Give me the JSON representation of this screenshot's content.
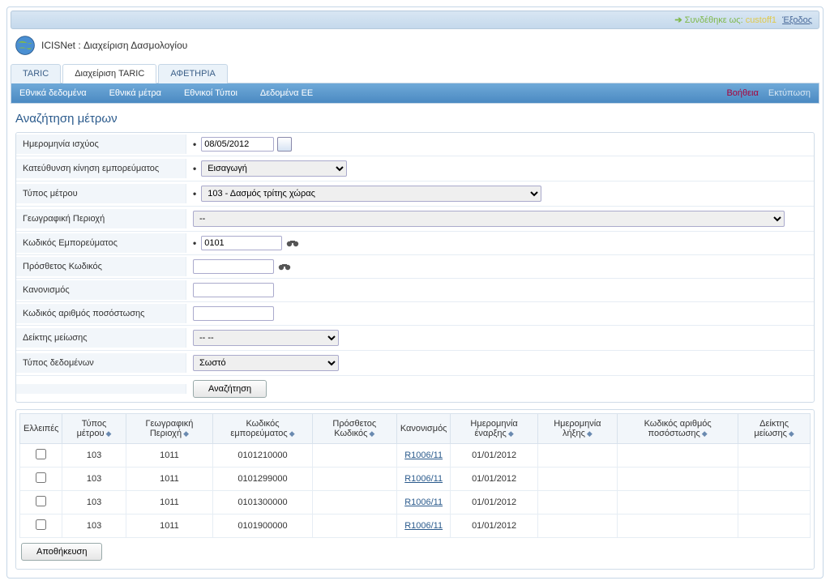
{
  "topbar": {
    "login_text": "Συνδέθηκε ως:",
    "user": "custoff1",
    "logout": "Έξοδος"
  },
  "brand": {
    "title": "ICISNet : Διαχείριση Δασμολογίου"
  },
  "tabs": [
    {
      "id": "taric",
      "label": "TARIC"
    },
    {
      "id": "manage-taric",
      "label": "Διαχείριση TARIC"
    },
    {
      "id": "departure",
      "label": "ΑΦΕΤΗΡΙΑ"
    }
  ],
  "menu": {
    "items": [
      "Εθνικά δεδομένα",
      "Εθνικά μέτρα",
      "Εθνικοί Τύποι",
      "Δεδομένα ΕΕ"
    ],
    "help": "Βοήθεια",
    "print": "Εκτύπωση"
  },
  "page": {
    "title": "Αναζήτηση μέτρων"
  },
  "form": {
    "validity_date": {
      "label": "Ημερομηνία ισχύος",
      "value": "08/05/2012"
    },
    "movement_direction": {
      "label": "Κατεύθυνση κίνηση εμπορεύματος",
      "value": "Εισαγωγή"
    },
    "measure_type": {
      "label": "Τύπος μέτρου",
      "value": "103 - Δασμός τρίτης χώρας"
    },
    "geo_area": {
      "label": "Γεωγραφική Περιοχή",
      "value": "--"
    },
    "commodity_code": {
      "label": "Κωδικός Εμπορεύματος",
      "value": "0101"
    },
    "additional_code": {
      "label": "Πρόσθετος Κωδικός",
      "value": ""
    },
    "regulation": {
      "label": "Κανονισμός",
      "value": ""
    },
    "quota_number": {
      "label": "Κωδικός αριθμός ποσόστωσης",
      "value": ""
    },
    "reduction": {
      "label": "Δείκτης μείωσης",
      "value": "-- --"
    },
    "data_type": {
      "label": "Τύπος δεδομένων",
      "value": "Σωστό"
    },
    "search_btn": "Αναζήτηση"
  },
  "grid": {
    "headers": {
      "missing": "Ελλειπές",
      "measure_type": "Τύπος μέτρου",
      "geo_area": "Γεωγραφική Περιοχή",
      "commodity_code": "Κωδικός εμπορεύματος",
      "additional_code": "Πρόσθετος Κωδικός",
      "regulation": "Κανονισμός",
      "start_date": "Ημερομηνία έναρξης",
      "end_date": "Ημερομηνία λήξης",
      "quota_number": "Κωδικός αριθμός ποσόστωσης",
      "reduction": "Δείκτης μείωσης"
    },
    "rows": [
      {
        "measure_type": "103",
        "geo_area": "1011",
        "commodity_code": "0101210000",
        "regulation": "R1006/11",
        "start_date": "01/01/2012"
      },
      {
        "measure_type": "103",
        "geo_area": "1011",
        "commodity_code": "0101299000",
        "regulation": "R1006/11",
        "start_date": "01/01/2012"
      },
      {
        "measure_type": "103",
        "geo_area": "1011",
        "commodity_code": "0101300000",
        "regulation": "R1006/11",
        "start_date": "01/01/2012"
      },
      {
        "measure_type": "103",
        "geo_area": "1011",
        "commodity_code": "0101900000",
        "regulation": "R1006/11",
        "start_date": "01/01/2012"
      }
    ],
    "save_btn": "Αποθήκευση"
  }
}
